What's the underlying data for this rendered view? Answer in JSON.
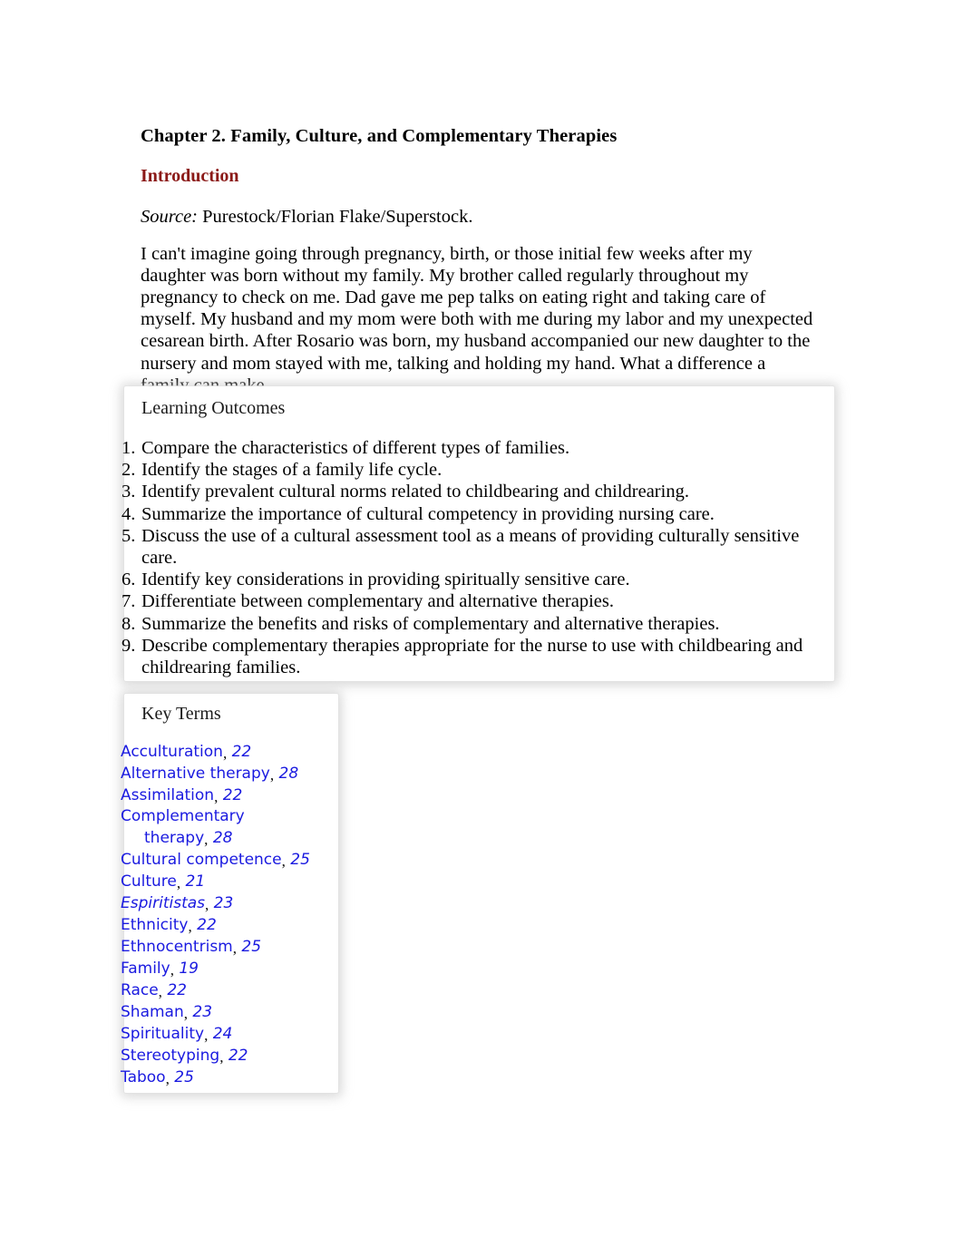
{
  "document": {
    "chapter_title": "Chapter 2. Family, Culture, and Complementary Therapies",
    "section_heading": "Introduction",
    "source": {
      "label": "Source:",
      "credit": "Purestock/Florian Flake/Superstock."
    },
    "intro_paragraph": "I can't imagine going through pregnancy, birth, or those initial few weeks after my daughter was born without my family. My brother called regularly throughout my pregnancy to check on me. Dad gave me pep talks on eating right and taking care of myself. My husband and my mom were both with me during my labor and my unexpected cesarean birth. After Rosario was born, my husband accompanied our new daughter to the nursery and mom stayed with me, talking and holding my hand. What a difference a family can make."
  },
  "learning_outcomes": {
    "title": "Learning Outcomes",
    "items": [
      {
        "number": "1.",
        "text": "Compare the characteristics of different types of families."
      },
      {
        "number": "2.",
        "text": "Identify the stages of a family life cycle."
      },
      {
        "number": "3.",
        "text": "Identify prevalent cultural norms related to childbearing and childrearing."
      },
      {
        "number": "4.",
        "text": "Summarize the importance of cultural competency in providing nursing care."
      },
      {
        "number": "5.",
        "text": "Discuss the use of a cultural assessment tool as a means of providing culturally sensitive care."
      },
      {
        "number": "6.",
        "text": "Identify key considerations in providing spiritually sensitive care."
      },
      {
        "number": "7.",
        "text": "Differentiate between complementary and alternative therapies."
      },
      {
        "number": "8.",
        "text": "Summarize the benefits and risks of complementary and alternative therapies."
      },
      {
        "number": "9.",
        "text": "Describe complementary therapies appropriate for the nurse to use with childbearing and childrearing families."
      }
    ]
  },
  "key_terms": {
    "title": "Key Terms",
    "separator": ",",
    "items": [
      {
        "term": "Acculturation",
        "page": "22",
        "italic": false,
        "wrapped": false
      },
      {
        "term": "Alternative therapy",
        "page": "28",
        "italic": false,
        "wrapped": false
      },
      {
        "term": "Assimilation",
        "page": "22",
        "italic": false,
        "wrapped": false
      },
      {
        "term": "Complementary therapy",
        "page": "28",
        "italic": false,
        "wrapped": true
      },
      {
        "term": "Cultural competence",
        "page": "25",
        "italic": false,
        "wrapped": false
      },
      {
        "term": "Culture",
        "page": "21",
        "italic": false,
        "wrapped": false
      },
      {
        "term": "Espiritistas",
        "page": "23",
        "italic": true,
        "wrapped": false
      },
      {
        "term": "Ethnicity",
        "page": "22",
        "italic": false,
        "wrapped": false
      },
      {
        "term": "Ethnocentrism",
        "page": "25",
        "italic": false,
        "wrapped": false
      },
      {
        "term": "Family",
        "page": "19",
        "italic": false,
        "wrapped": false
      },
      {
        "term": "Race",
        "page": "22",
        "italic": false,
        "wrapped": false
      },
      {
        "term": "Shaman",
        "page": "23",
        "italic": false,
        "wrapped": false
      },
      {
        "term": "Spirituality",
        "page": "24",
        "italic": false,
        "wrapped": false
      },
      {
        "term": "Stereotyping",
        "page": "22",
        "italic": false,
        "wrapped": false
      },
      {
        "term": "Taboo",
        "page": "25",
        "italic": false,
        "wrapped": false
      }
    ]
  },
  "colors": {
    "heading_accent": "#8B1A18",
    "key_term_link": "#1A1AE0",
    "body_text": "#000000",
    "page_background": "#FFFFFF"
  }
}
